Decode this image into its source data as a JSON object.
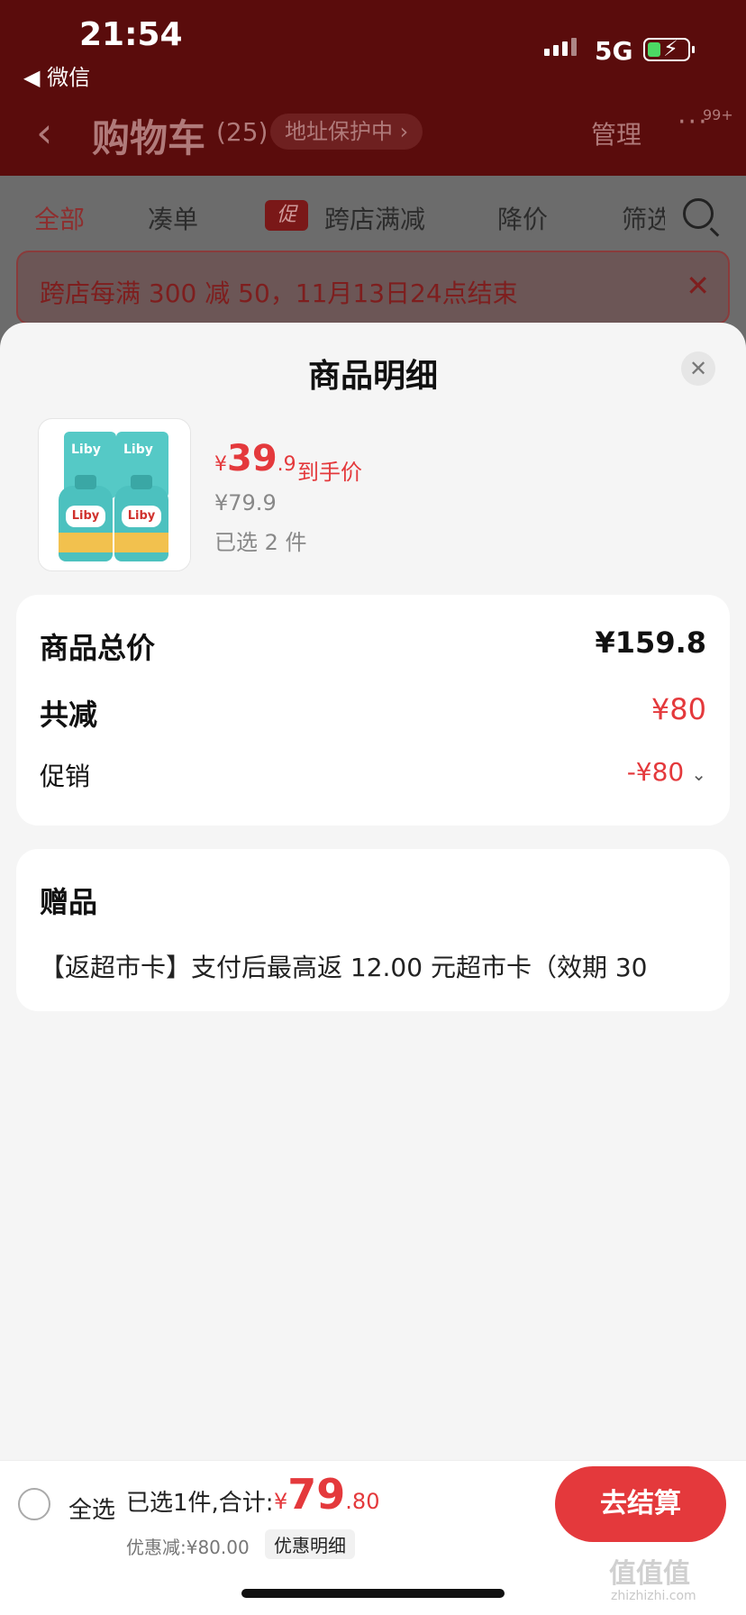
{
  "status_bar": {
    "time": "21:54",
    "back_app": "◀ 微信",
    "network": "5G"
  },
  "nav": {
    "title": "购物车",
    "count": "(25)",
    "address_protect": "地址保护中 ›",
    "manage": "管理",
    "more_badge": "99+"
  },
  "filters": {
    "all": "全部",
    "combine": "凑单",
    "promo_tag": "促",
    "cross_store": "跨店满减",
    "price_drop": "降价",
    "filter": "筛选"
  },
  "promo_banner": {
    "text": "跨店每满 300 减 50，11月13日24点结束"
  },
  "sheet": {
    "title": "商品明细",
    "product": {
      "brand": "Liby",
      "price_symbol": "¥",
      "price_int": "39",
      "price_dec": ".9",
      "price_tag": "到手价",
      "original_price": "¥79.9",
      "selected": "已选 2 件"
    },
    "summary": {
      "total_label": "商品总价",
      "total_value": "¥159.8",
      "discount_label": "共减",
      "discount_value": "¥80",
      "promo_label": "促销",
      "promo_value": "-¥80"
    },
    "gift": {
      "title": "赠品",
      "text": "【返超市卡】支付后最高返 12.00 元超市卡（效期 30"
    }
  },
  "bottom_bar": {
    "select_all": "全选",
    "selected_total_label": "已选1件,合计:",
    "total_symbol": "¥",
    "total_int": "79",
    "total_dec": ".80",
    "discount_text": "优惠减:¥80.00",
    "discount_detail": "优惠明细",
    "checkout": "去结算"
  },
  "watermark": {
    "main": "值值值",
    "sub": "zhizhizhi.com"
  },
  "colors": {
    "accent": "#e4393c",
    "header_bg": "#5a0c0c",
    "sheet_bg": "#f5f5f5"
  }
}
